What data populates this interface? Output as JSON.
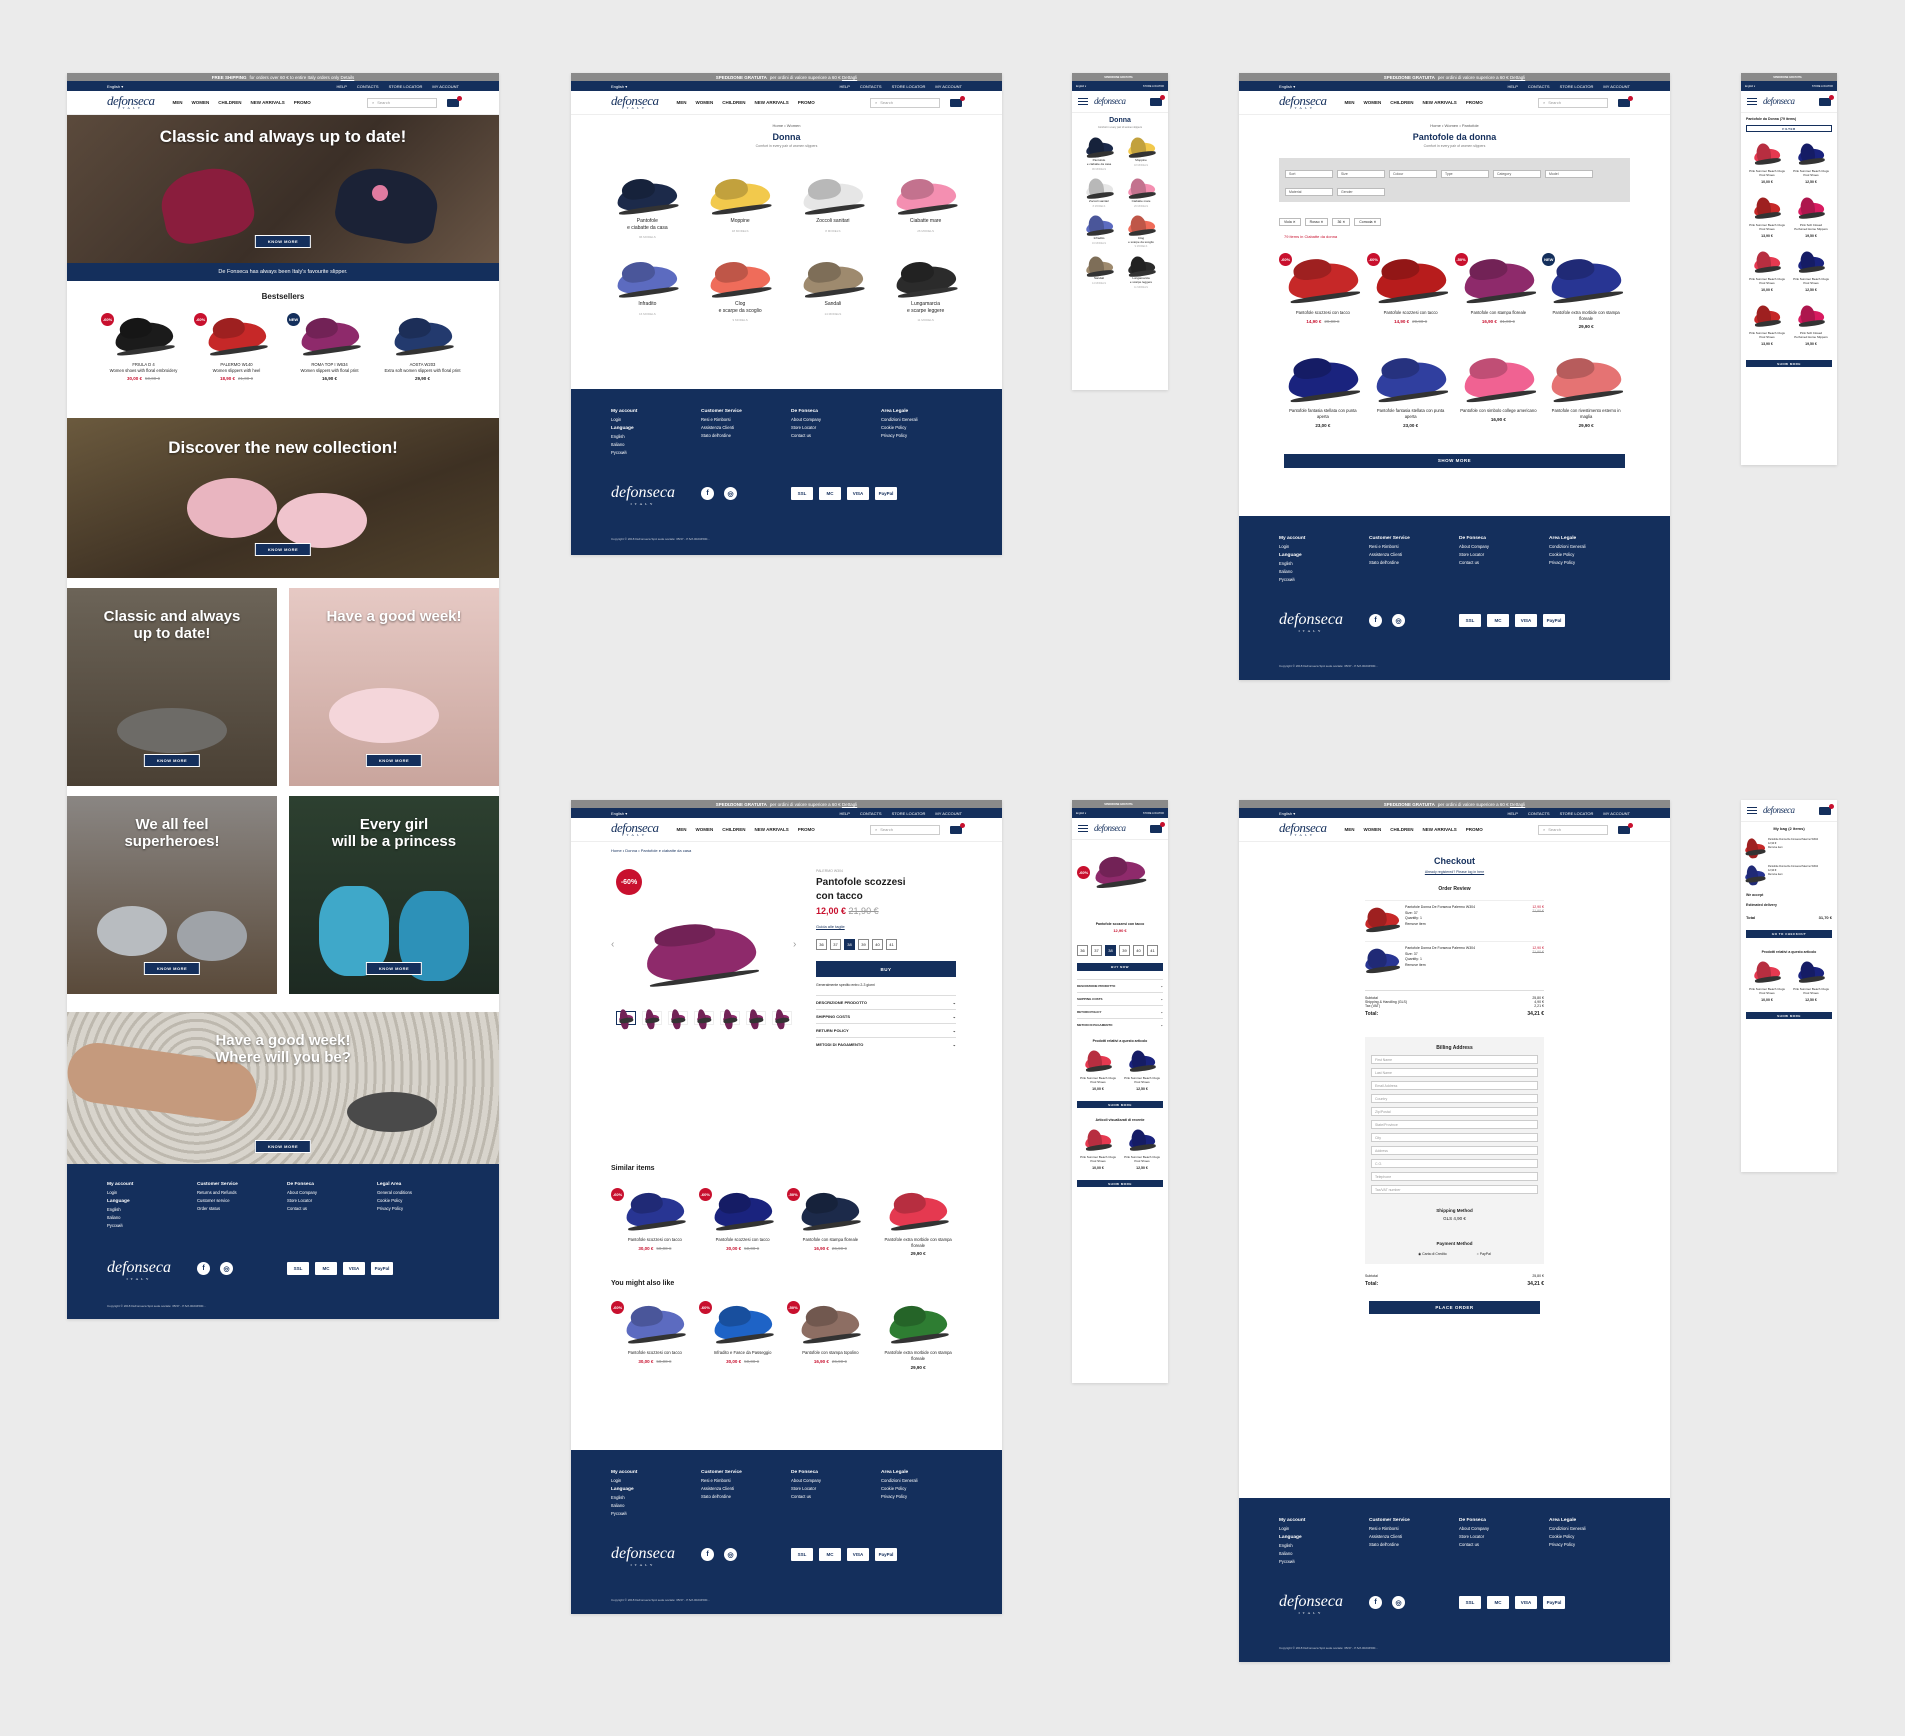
{
  "promo_en": {
    "bold": "FREE SHIPPING",
    "text": "for orders over 60 € to entire Italy orders only",
    "link": "Details"
  },
  "promo_it": {
    "bold": "SPEDIZIONE GRATUITA",
    "text": "per ordini di valore superiore a 60 €",
    "link": "Dettagli"
  },
  "nav": {
    "language": "English ▾",
    "help": "HELP",
    "contacts": "CONTACTS",
    "store_locator": "STORE LOCATOR",
    "my_account": "MY ACCOUNT"
  },
  "header": {
    "logo": "defonseca",
    "logo_sub": "ITALY",
    "search_placeholder": "Search",
    "menu": [
      "MEN",
      "WOMEN",
      "CHILDREN",
      "NEW ARRIVALS",
      "PROMO"
    ]
  },
  "home": {
    "hero_title": "Classic and always up to date!",
    "know_more": "KNOW MORE",
    "banner_text": "De Fonseca has always been Italy's favourite slipper.",
    "bestsellers_title": "Bestsellers",
    "products": [
      {
        "badge": "-60%",
        "name": "FRIULA D 4\nWomen shoes with floral embroidery",
        "price": "30,00 €",
        "old": "50,00 €",
        "color": "#1b1b1b"
      },
      {
        "badge": "-60%",
        "name": "PALERMO W140\nWomen slippers with heel",
        "price": "18,90 €",
        "old": "21,00 €",
        "color": "#c62828"
      },
      {
        "badge": "NEW",
        "name": "ROMA TOP I W634\nWomen slippers with floral print",
        "price": "16,90 €",
        "old": "",
        "color": "#8e2a6b"
      },
      {
        "badge": "",
        "name": "AOSTA W203\nExtra soft women slippers with floral print",
        "price": "29,90 €",
        "old": "",
        "color": "#233a6e"
      }
    ],
    "collection_title": "Discover the new collection!",
    "tile1": "Classic and always\nup to date!",
    "tile2": "Have a good week!",
    "tile3": "We all feel\nsuperheroes!",
    "tile4": "Every girl\nwill be a princess",
    "tile5": "Have a good week!\nWhere will you be?"
  },
  "footer_en": {
    "col1": [
      "My account",
      "Login"
    ],
    "lang_title": "Language",
    "langs": [
      "English",
      "Italiano",
      "Русский"
    ],
    "col2": [
      "Customer Service",
      "Returns and Refunds",
      "Customer service",
      "Order status"
    ],
    "col3": [
      "De Fonseca",
      "About Company",
      "Store Locator",
      "Contact us"
    ],
    "col4": [
      "Legal Area",
      "General conditions",
      "Cookie Policy",
      "Privacy Policy"
    ],
    "copyright": "Copyright © 2018 DeFonseca SpA sede sociale: 35/37 - P.IVA 00234500..."
  },
  "footer_it": {
    "col1": [
      "My account",
      "Login"
    ],
    "lang_title": "Language",
    "langs": [
      "English",
      "Italiano",
      "Русский"
    ],
    "col2": [
      "Customer Service",
      "Resi e Rimborsi",
      "Assistenza Clienti",
      "Stato dell'ordine"
    ],
    "col3": [
      "De Fonseca",
      "About Company",
      "Store Locator",
      "Contact us"
    ],
    "col4": [
      "Area Legale",
      "Condizioni Generali",
      "Cookie Policy",
      "Privacy Policy"
    ],
    "copyright": "Copyright © 2018 DeFonseca SpA sede sociale: 35/37 - P.IVA 00234500..."
  },
  "payments": [
    "SSL",
    "MC",
    "VISA",
    "PayPal"
  ],
  "social": [
    "f",
    "◎"
  ],
  "donna": {
    "crumb": "Home  •  Women",
    "title": "Donna",
    "subtitle": "Comfort in every pair of women slippers",
    "categories": [
      {
        "name": "Pantofole\ne ciabatte da casa",
        "count": "96 MODELS",
        "color": "#1c2a4a"
      },
      {
        "name": "Moppine",
        "count": "18 MODELS",
        "color": "#f2c94c"
      },
      {
        "name": "Zoccoli sanitari",
        "count": "8 MODELS",
        "color": "#e6e6e6"
      },
      {
        "name": "Ciabatte mare",
        "count": "26 MODELS",
        "color": "#f48fb1"
      },
      {
        "name": "Infradito",
        "count": "16 MODELS",
        "color": "#5c6bc0"
      },
      {
        "name": "Clog\ne scarpe da scoglio",
        "count": "9 MODELS",
        "color": "#ef6c5a"
      },
      {
        "name": "Sandali",
        "count": "14 MODELS",
        "color": "#9e8a6e"
      },
      {
        "name": "Lungamarcia\ne scarpe leggere",
        "count": "11 MODELS",
        "color": "#2b2b2b"
      }
    ]
  },
  "plp": {
    "crumb": "Home  •  Women  •  Pantofole",
    "title": "Pantofole da donna",
    "filters": [
      "Sort",
      "Size",
      "Colour",
      "Type",
      "Category",
      "Model",
      "Material",
      "Gender"
    ],
    "chips": [
      "Viola ✕",
      "Rosso ✕",
      "36 ✕",
      "Comoda ✕"
    ],
    "count": "79 items in Ciabatte da donna",
    "products": [
      {
        "badge": "-60%",
        "name": "Pantofole scozzesi con tacco",
        "price": "14,90 €",
        "old": "29,90 €",
        "color": "#c62828"
      },
      {
        "badge": "-60%",
        "name": "Pantofole scozzesi con tacco",
        "price": "14,90 €",
        "old": "29,90 €",
        "color": "#b71c1c"
      },
      {
        "badge": "-50%",
        "name": "Pantofole con stampa floreale",
        "price": "16,90 €",
        "old": "31,00 €",
        "color": "#8e2a6b"
      },
      {
        "badge": "NEW",
        "name": "Pantofole extra morbide con stampa floreale",
        "price": "29,90 €",
        "old": "",
        "color": "#283593"
      },
      {
        "badge": "",
        "name": "Pantofole fantasia stellata con punta aperta",
        "price": "23,00 €",
        "old": "",
        "color": "#1a237e"
      },
      {
        "badge": "",
        "name": "Pantofole fantasia stellata con punta aperta",
        "price": "23,00 €",
        "old": "",
        "color": "#303f9f"
      },
      {
        "badge": "",
        "name": "Pantofole con simbolo college americano",
        "price": "16,90 €",
        "old": "",
        "color": "#f06292"
      },
      {
        "badge": "",
        "name": "Pantofole con rivestimento esterno in maglia",
        "price": "29,90 €",
        "old": "",
        "color": "#e57373"
      }
    ],
    "show_more": "SHOW MORE"
  },
  "pdp": {
    "crumb": "Home  •  Donna  •  Pantofole e ciabatte da casa",
    "badge": "-60%",
    "title": "Pantofole scozzesi\ncon tacco",
    "price": "12,00 €",
    "old": "21,90 €",
    "size_guide": "Guida alle taglie",
    "sizes": [
      "36",
      "37",
      "38",
      "39",
      "40",
      "41"
    ],
    "buy": "BUY",
    "delivery": "Generalmente spedito entro 2-3 giorni",
    "acc": [
      "DESCRIZIONE PRODOTTO",
      "SHIPPING COSTS",
      "RETURN POLICY",
      "METODI DI PAGAMENTO"
    ],
    "similar_title": "Similar items",
    "similar": [
      {
        "badge": "-60%",
        "name": "Pantofole scozzesi con tacco",
        "price": "30,00 €",
        "old": "50,00 €",
        "color": "#283593"
      },
      {
        "badge": "-60%",
        "name": "Pantofole scozzesi con tacco",
        "price": "30,00 €",
        "old": "50,00 €",
        "color": "#1a237e"
      },
      {
        "badge": "-50%",
        "name": "Pantofole con stampa floreale",
        "price": "16,90 €",
        "old": "26,90 €",
        "color": "#1c2a4a"
      },
      {
        "badge": "",
        "name": "Pantofole extra morbide con stampa floreale",
        "price": "29,90 €",
        "old": "",
        "color": "#e53950"
      }
    ],
    "like_title": "You might also like",
    "like": [
      {
        "badge": "-60%",
        "name": "Pantofole scozzesi con tacco",
        "price": "30,00 €",
        "old": "50,00 €",
        "color": "#5c6bc0"
      },
      {
        "badge": "-60%",
        "name": "Infradito e Fasce da Passeggio",
        "price": "30,00 €",
        "old": "50,00 €",
        "color": "#1e63c6"
      },
      {
        "badge": "-50%",
        "name": "Pantofole con stampa topolino",
        "price": "16,90 €",
        "old": "26,90 €",
        "color": "#8d6e63"
      },
      {
        "badge": "",
        "name": "Pantofole extra morbide con stampa floreale",
        "price": "29,90 €",
        "old": "",
        "color": "#2e7d32"
      }
    ]
  },
  "checkout": {
    "title": "Checkout",
    "login": "Already registered? Please log in here",
    "review": "Order Review",
    "items": [
      {
        "name": "Pantofole Donna De Fonseca Palermo W304",
        "size": "Size: 37",
        "qty": "Quantity: 1",
        "remove": "Remove item",
        "price": "12,90 €",
        "old": "21,90 €",
        "color": "#c62828"
      },
      {
        "name": "Pantofole Donna De Fonseca Palermo W304",
        "size": "Size: 37",
        "qty": "Quantity: 1",
        "remove": "Remove item",
        "price": "12,90 €",
        "old": "21,90 €",
        "color": "#283593"
      }
    ],
    "subtotal_l": "Subtotal",
    "subtotal": "25,80 €",
    "shipping_l": "Shipping & Handling (GLS)",
    "shipping": "4,90 €",
    "tax_l": "Tax (VAT)",
    "tax": "2,21 €",
    "total_l": "Total:",
    "total": "34,21 €",
    "billing": "Billing Address",
    "fields": [
      "First Name",
      "Last Name",
      "Email Address",
      "Country",
      "Zip/Postal",
      "State/Province",
      "City",
      "Address",
      "C.O.",
      "Telephone",
      "Tax/VAT number"
    ],
    "ship_method": "Shipping Method",
    "ship_price": "GLS 4,90 €",
    "pay_method": "Payment Method",
    "card": "Carta di Credito",
    "paypal": "PayPal",
    "place": "PLACE ORDER"
  },
  "mobile": {
    "cat_title": "Donna",
    "plp_title": "Pantofole da Donna (79 items)",
    "filter": "FILTER",
    "items": [
      {
        "name": "Pink Summer Beach Clogs Pool Shoes",
        "price": "10,00 €",
        "color": "#e53950"
      },
      {
        "name": "Pink Summer Beach Clogs Pool Shoes",
        "price": "12,50 €",
        "color": "#1a237e"
      },
      {
        "name": "Pink Summer Beach Clogs Pool Shoes",
        "price": "13,90 €",
        "color": "#c62828"
      },
      {
        "name": "Pink Soft Closed Perfumed Home Slippers",
        "price": "19,50 €",
        "color": "#d81b60"
      }
    ],
    "pdp_title": "Pantofole scozzesi con tacco",
    "pdp_price": "12,90 €",
    "buy_now": "BUY NOW",
    "related": "Prodotti relativi a questo articolo",
    "recent": "Articoli visualizzati di recente",
    "bag_title": "My bag (2 items)",
    "we_accept": "We accept",
    "est": "Estimated delivery",
    "bag_total_l": "Total",
    "bag_total": "31,70 €",
    "go_checkout": "GO TO CHECKOUT"
  }
}
